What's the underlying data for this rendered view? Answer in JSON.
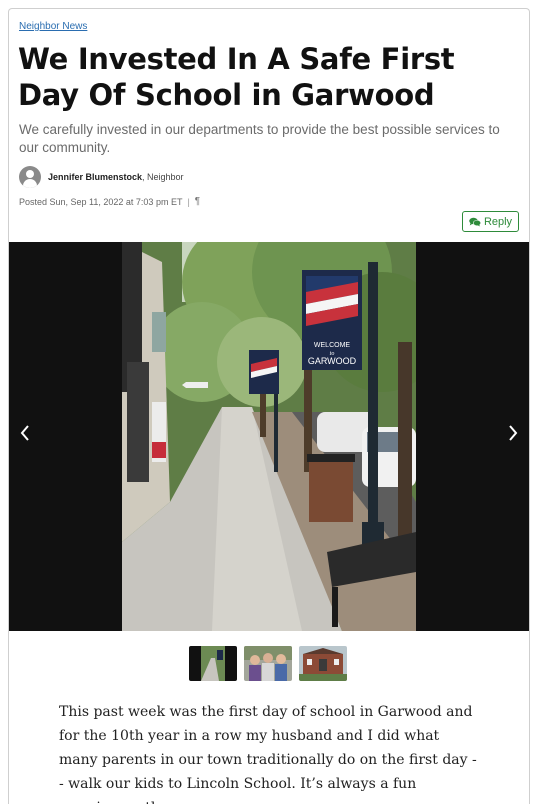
{
  "article": {
    "category": "Neighbor News",
    "title": "We Invested In A Safe First Day Of School in Garwood",
    "subtitle": "We carefully invested in our departments to provide the best possible services to our community.",
    "author": "Jennifer Blumenstock",
    "author_role": ", Neighbor",
    "posted": "Posted Sun, Sep 11, 2022 at 7:03 pm ET",
    "separator": "|",
    "pilcrow": "¶",
    "reply_label": "Reply",
    "body": "This past week was the first day of school in Garwood and for the 10th year in a row my husband and I did what many parents in our town traditionally do on the first day -- walk our kids to Lincoln School. It’s always a fun morning on the"
  },
  "gallery": {
    "banner_text_1": "WELCOME",
    "banner_text_2": "to",
    "banner_text_3": "GARWOOD",
    "prev_icon": "chevron-left-icon",
    "next_icon": "chevron-right-icon",
    "thumbnail_count": 3
  },
  "colors": {
    "link": "#2a6db0",
    "reply_green": "#2e8b3a",
    "gallery_bg": "#111111"
  }
}
